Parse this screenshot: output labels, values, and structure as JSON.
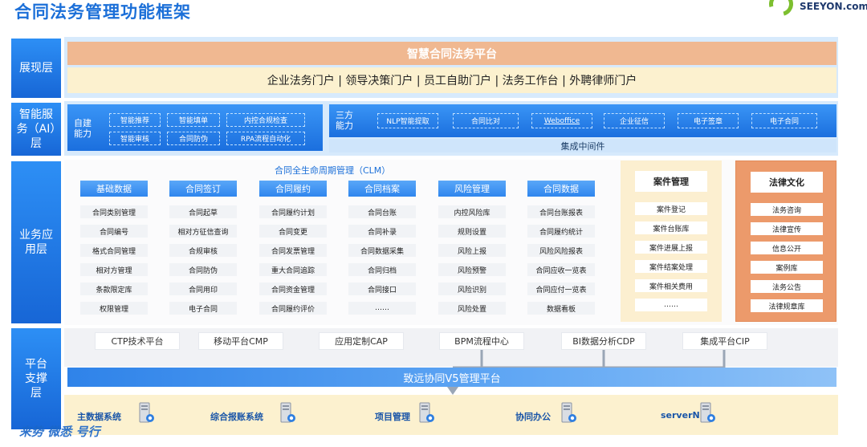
{
  "title": "合同法务管理功能框架",
  "logo": {
    "brand": "SEEYON.com"
  },
  "layers": {
    "presentation": "展现层",
    "ai": "智能服务（AI）层",
    "business": "业务应用层",
    "platform": "平台支撑层"
  },
  "presentation": {
    "platform_name": "智慧合同法务平台",
    "portals": "企业法务门户 | 领导决策门户 | 员工自助门户 | 法务工作台 | 外聘律师门户"
  },
  "ai": {
    "self_label": "自建能力",
    "self_items": [
      "智能推荐",
      "智能填单",
      "内控合规检查",
      "智能审核",
      "合同防伪",
      "RPA流程自动化"
    ],
    "third_label": "三方能力",
    "third_items": [
      "NLP智能提取",
      "合同比对",
      "Weboffice",
      "企业征信",
      "电子签章",
      "电子合同"
    ],
    "middleware": "集成中间件"
  },
  "clm": {
    "title": "合同全生命周期管理（CLM）",
    "columns": [
      {
        "head": "基础数据",
        "items": [
          "合同类别管理",
          "合同编号",
          "格式合同管理",
          "相对方管理",
          "条款限定库",
          "权限管理"
        ]
      },
      {
        "head": "合同签订",
        "items": [
          "合同起草",
          "相对方征信查询",
          "合规审核",
          "合同防伪",
          "合同用印",
          "电子合同"
        ]
      },
      {
        "head": "合同履约",
        "items": [
          "合同履约计划",
          "合同变更",
          "合同发票管理",
          "重大合同追踪",
          "合同资金管理",
          "合同履约评价"
        ]
      },
      {
        "head": "合同档案",
        "items": [
          "合同台账",
          "合同补录",
          "合同数据采集",
          "合同归档",
          "合同接口",
          "……"
        ]
      },
      {
        "head": "风险管理",
        "items": [
          "内控风险库",
          "规则设置",
          "风险上报",
          "风险预警",
          "风险识别",
          "风险处置"
        ]
      },
      {
        "head": "合同数据",
        "items": [
          "合同台账报表",
          "合同履约统计",
          "风险风险报表",
          "合同应收一览表",
          "合同应付一览表",
          "数据看板"
        ]
      }
    ]
  },
  "case_mgmt": {
    "head": "案件管理",
    "items": [
      "案件登记",
      "案件台账库",
      "案件进展上报",
      "案件结案处理",
      "案件相关费用",
      "……"
    ]
  },
  "legal_culture": {
    "head": "法律文化",
    "items": [
      "法务咨询",
      "法律宣传",
      "信息公开",
      "案例库",
      "法务公告",
      "法律规章库"
    ]
  },
  "platform": {
    "items": [
      "CTP技术平台",
      "移动平台CMP",
      "应用定制CAP",
      "BPM流程中心",
      "BI数据分析CDP",
      "集成平台CIP"
    ],
    "v5": "致远协同V5管理平台",
    "systems": [
      "主数据系统",
      "综合报账系统",
      "项目管理",
      "协同办公",
      "serverN"
    ]
  },
  "watermark": "来势 微悉 号行",
  "colors": {
    "accent": "#1b6fd8",
    "orange": "#ec9a6b",
    "cream": "#fcf1cf"
  }
}
